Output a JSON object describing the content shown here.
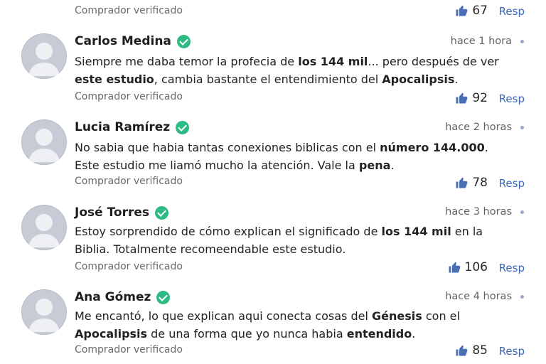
{
  "colors": {
    "accent": "#3c66b8",
    "verified_badge": "#2dbb83",
    "avatar": "#c7cbd6"
  },
  "top_partial": {
    "verified_label": "Comprador verificado",
    "likes": "67",
    "reply_label": "Resp"
  },
  "comments": [
    {
      "name": "Carlos Medina",
      "time": "hace 1 hora",
      "text_parts": [
        {
          "t": "Siempre me daba temor la profecia de ",
          "b": false
        },
        {
          "t": "los 144 mil",
          "b": true
        },
        {
          "t": "... pero después de ver ",
          "b": false
        },
        {
          "t": "este estudio",
          "b": true
        },
        {
          "t": ", cambia bastante el entendimiento del ",
          "b": false
        },
        {
          "t": "Apocalipsis",
          "b": true
        },
        {
          "t": ".",
          "b": false
        }
      ],
      "verified_label": "Comprador verificado",
      "likes": "92",
      "reply_label": "Resp"
    },
    {
      "name": "Lucia Ramírez",
      "time": "hace 2 horas",
      "text_parts": [
        {
          "t": "No sabia que habia tantas conexiones biblicas con el ",
          "b": false
        },
        {
          "t": "número 144.000",
          "b": true
        },
        {
          "t": ". Este estudio me liamó mucho la atención. Vale la ",
          "b": false
        },
        {
          "t": "pena",
          "b": true
        },
        {
          "t": ".",
          "b": false
        }
      ],
      "verified_label": "Comprador verificado",
      "likes": "78",
      "reply_label": "Resp"
    },
    {
      "name": "José Torres",
      "time": "hace 3 horas",
      "text_parts": [
        {
          "t": "Estoy sorprendido de cómo explican el significado de ",
          "b": false
        },
        {
          "t": "los 144 mil",
          "b": true
        },
        {
          "t": " en la Biblia. Totalmente recomeendable este estudio.",
          "b": false
        }
      ],
      "verified_label": "Comprador verificado",
      "likes": "106",
      "reply_label": "Resp"
    },
    {
      "name": "Ana Gómez",
      "time": "hace 4 horas",
      "text_parts": [
        {
          "t": "Me encantó, lo que explican aqui conecta cosas del ",
          "b": false
        },
        {
          "t": "Génesis",
          "b": true
        },
        {
          "t": " con el ",
          "b": false
        },
        {
          "t": "Apocalipsis",
          "b": true
        },
        {
          "t": " de una forma que yo nunca habia ",
          "b": false
        },
        {
          "t": "entendido",
          "b": true
        },
        {
          "t": ".",
          "b": false
        }
      ],
      "verified_label": "Comprador verificado",
      "likes": "85",
      "reply_label": "Resp"
    }
  ]
}
